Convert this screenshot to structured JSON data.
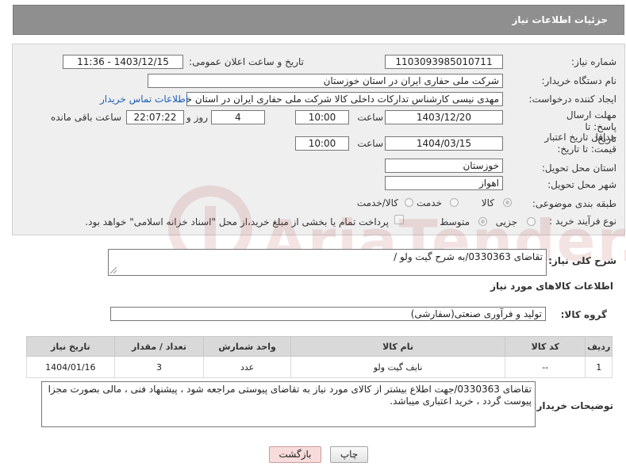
{
  "header": {
    "title": "جزئیات اطلاعات نیاز"
  },
  "need_number": {
    "label": "شماره نیاز:",
    "value": "1103093985010711"
  },
  "announce_datetime": {
    "label": "تاریخ و ساعت اعلان عمومی:",
    "value": "1403/12/15 - 11:36"
  },
  "buyer_org": {
    "label": "نام دستگاه خریدار:",
    "value": "شرکت ملی حفاری ایران در استان خوزستان"
  },
  "requester": {
    "label": "ایجاد کننده درخواست:",
    "value": "مهدی نیسی کارشناس تدارکات داخلی کالا شرکت ملی حفاری ایران در استان خوزستان",
    "contact_link": "اطلاعات تماس خریدار"
  },
  "deadline": {
    "label": "مهلت ارسال پاسخ: تا تاریخ:",
    "date": "1403/12/20",
    "time_label": "ساعت",
    "time": "10:00",
    "days": "4",
    "days_label": "روز و",
    "remaining": "22:07:22",
    "remaining_label": "ساعت باقی مانده"
  },
  "price_validity": {
    "label": "حداقل تاریخ اعتبار قیمت: تا تاریخ:",
    "date": "1404/03/15",
    "time_label": "ساعت",
    "time": "10:00"
  },
  "delivery_province": {
    "label": "استان محل تحویل:",
    "value": "خوزستان"
  },
  "delivery_city": {
    "label": "شهر محل تحویل:",
    "value": "اهواز"
  },
  "category": {
    "label": "طبقه بندی موضوعی:",
    "options": [
      "کالا",
      "خدمت",
      "کالا/خدمت"
    ],
    "selected": "کالا"
  },
  "purchase_type": {
    "label": "نوع فرآیند خرید :",
    "options": [
      "جزیی",
      "متوسط"
    ],
    "selected": "متوسط",
    "note": "پرداخت تمام یا بخشی از مبلغ خرید،از محل \"اسناد خزانه اسلامی\" خواهد بود."
  },
  "summary": {
    "label": "شرح کلی نیاز:",
    "value": "تقاضای 0330363/به شرح گیت ولو /"
  },
  "items_section": {
    "title": "اطلاعات کالاهای مورد نیاز"
  },
  "goods_group": {
    "label": "گروه کالا:",
    "value": "تولید و فرآوری صنعتی(سفارشی)"
  },
  "items_table": {
    "headers": [
      "ردیف",
      "کد کالا",
      "نام کالا",
      "واحد شمارش",
      "تعداد / مقدار",
      "تاریخ نیاز"
    ],
    "rows": [
      {
        "row": "1",
        "code": "--",
        "name": "نایف گیت ولو",
        "unit": "عدد",
        "qty": "3",
        "date": "1404/01/16"
      }
    ]
  },
  "buyer_notes": {
    "label": "توضیحات خریدار:",
    "value": "تقاضای 0330363/جهت اطلاع بیشتر از کالای مورد نیاز به تقاضای پیوستی مراجعه شود ، پیشنهاد فنی ، مالی بصورت مجزا پیوست گردد ، خرید اعتباری میباشد."
  },
  "buttons": {
    "print": "چاپ",
    "back": "بازگشت"
  },
  "watermark": {
    "text": "AriaTender.net"
  },
  "colors": {
    "header_bg": "#8f8f8f",
    "panel_bg": "#efefef",
    "link": "#1b5fb8",
    "watermark": "#b23030",
    "back_button": "#f8dcdc"
  }
}
